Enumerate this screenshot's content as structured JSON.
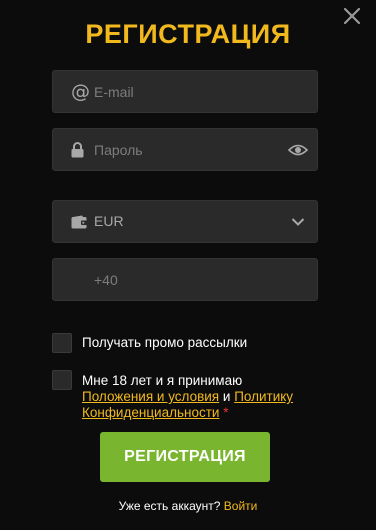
{
  "modal": {
    "title": "РЕГИСТРАЦИЯ",
    "close_icon": "close-icon"
  },
  "form": {
    "email": {
      "placeholder": "E-mail",
      "value": "",
      "icon": "at-icon"
    },
    "password": {
      "placeholder": "Пароль",
      "value": "",
      "icon": "lock-icon",
      "toggle_icon": "eye-icon"
    },
    "currency": {
      "selected": "EUR",
      "icon": "wallet-icon",
      "dropdown_icon": "chevron-down-icon"
    },
    "phone": {
      "placeholder": "+40",
      "value": ""
    },
    "promo": {
      "label": "Получать промо рассылки",
      "checked": false
    },
    "terms": {
      "prefix": "Мне 18 лет и я принимаю",
      "link1": "Положения и условия",
      "conjunction": "и",
      "link2a": "Политику",
      "link2b": "Конфиденциальности",
      "required_mark": "*",
      "checked": false
    },
    "submit_label": "РЕГИСТРАЦИЯ"
  },
  "footer": {
    "question": "Уже есть аккаунт?",
    "login_link": "Войти"
  },
  "colors": {
    "background": "#0c0c0c",
    "accent": "#f2b91f",
    "field_bg": "#2a2a2a",
    "submit_bg": "#79b52f",
    "required": "#e33333"
  }
}
